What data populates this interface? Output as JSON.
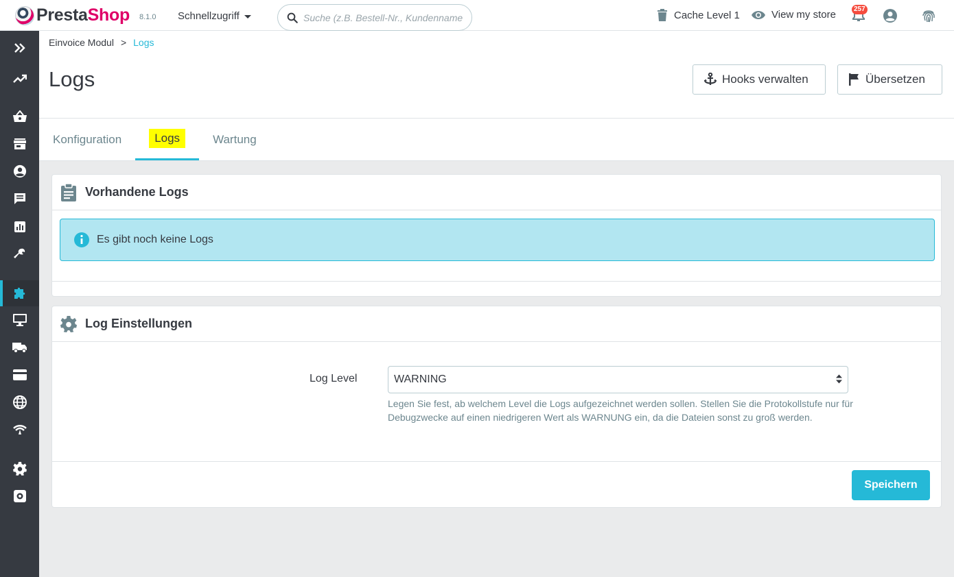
{
  "header": {
    "brand_presta": "Presta",
    "brand_shop": "Shop",
    "version": "8.1.0",
    "quick_access": "Schnellzugriff",
    "search_placeholder": "Suche (z.B. Bestell-Nr., Kundenname …",
    "cache": "Cache Level 1",
    "view_store": "View my store",
    "notifications_count": "257"
  },
  "sidebar": {
    "items": [
      "expand-icon",
      "trend-icon",
      "basket-icon",
      "store-icon",
      "customer-icon",
      "chat-icon",
      "chart-icon",
      "wrench-icon",
      "puzzle-icon",
      "monitor-icon",
      "truck-icon",
      "credit-card-icon",
      "globe-icon",
      "network-icon",
      "gear-icon",
      "gear-box-icon"
    ],
    "active": "puzzle-icon"
  },
  "breadcrumb": {
    "parent": "Einvoice Modul",
    "separator": ">",
    "current": "Logs"
  },
  "page": {
    "title": "Logs",
    "hooks_button": "Hooks verwalten",
    "translate_button": "Übersetzen"
  },
  "tabs": [
    {
      "label": "Konfiguration"
    },
    {
      "label": "Logs"
    },
    {
      "label": "Wartung"
    }
  ],
  "logs_panel": {
    "title": "Vorhandene Logs",
    "alert": "Es gibt noch keine Logs"
  },
  "settings_panel": {
    "title": "Log Einstellungen",
    "log_level_label": "Log Level",
    "log_level_value": "WARNING",
    "help": "Legen Sie fest, ab welchem Level die Logs aufgezeichnet werden sollen. Stellen Sie die Protokollstufe nur für Debugzwecke auf einen niedrigeren Wert als WARNUNG ein, da die Dateien sonst zu groß werden.",
    "save_button": "Speichern"
  },
  "colors": {
    "accent": "#25b9d7",
    "sidebar": "#363a41",
    "brand_pink": "#df0067",
    "alert_bg": "#b2e6f1",
    "tab_highlight": "#ffff00"
  }
}
